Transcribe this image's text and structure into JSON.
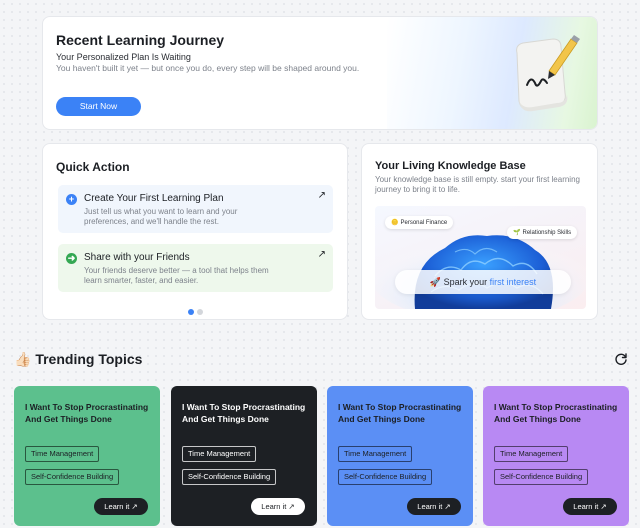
{
  "journey": {
    "title": "Recent Learning Journey",
    "subtitle": "Your Personalized Plan Is Waiting",
    "description": "You haven't built it yet — but once you do, every step will be shaped around you.",
    "start_label": "Start Now"
  },
  "quick_action": {
    "title": "Quick Action",
    "items": [
      {
        "title": "Create Your First Learning Plan",
        "description": "Just tell us what you want to learn and your preferences, and we'll handle the rest.",
        "icon": "plus-icon"
      },
      {
        "title": "Share with your Friends",
        "description": "Your friends deserve better — a tool that helps them learn smarter, faster, and easier.",
        "icon": "share-arrow-icon"
      }
    ],
    "carousel": {
      "pages": 2,
      "active": 1
    }
  },
  "knowledge_base": {
    "title": "Your Living Knowledge Base",
    "description": "Your knowledge base is still empty. start your first learning journey to bring it to life.",
    "chips": [
      "Personal Finance",
      "Relationship Skills"
    ],
    "spark_prefix": "Spark your",
    "spark_accent": "first interest"
  },
  "trending": {
    "title": "Trending Topics",
    "emoji": "👍🏻",
    "topics": [
      {
        "title": "I Want To Stop Procrastinating And Get Things Done",
        "tags": [
          "Time Management",
          "Self-Confidence Building"
        ],
        "learn_label": "Learn it",
        "color": "#5cc08d"
      },
      {
        "title": "I Want To Stop Procrastinating And Get Things Done",
        "tags": [
          "Time Management",
          "Self-Confidence Building"
        ],
        "learn_label": "Learn it",
        "color": "#1d2024"
      },
      {
        "title": "I Want To Stop Procrastinating And Get Things Done",
        "tags": [
          "Time Management",
          "Self-Confidence Building"
        ],
        "learn_label": "Learn it",
        "color": "#5b8ff5"
      },
      {
        "title": "I Want To Stop Procrastinating And Get Things Done",
        "tags": [
          "Time Management",
          "Self-Confidence Building"
        ],
        "learn_label": "Learn it",
        "color": "#b889f3"
      }
    ]
  },
  "colors": {
    "accent": "#3b82f6",
    "success": "#34a853"
  }
}
